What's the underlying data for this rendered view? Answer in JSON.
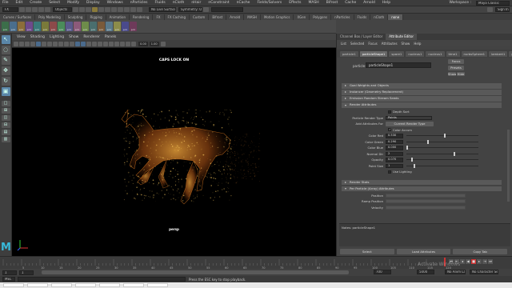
{
  "menubar": {
    "items": [
      "File",
      "Edit",
      "Create",
      "Select",
      "Modify",
      "Display",
      "Windows",
      "nParticles",
      "Fluids",
      "nCloth",
      "nHair",
      "nConstraint",
      "nCache",
      "Fields/Solvers",
      "Effects",
      "MASH",
      "Bifrost",
      "Cache",
      "Arnold",
      "Help"
    ],
    "workspace_label": "Workspace :",
    "workspace_value": "Maya Classic"
  },
  "statusline": {
    "mode": "FX",
    "objects": "Objects",
    "live_surface": "No Live Surface",
    "symmetry": "Symmetry: Off",
    "sign_in": "Sign In"
  },
  "shelf": {
    "tabs": [
      "Curves / Surfaces",
      "Poly Modeling",
      "Sculpting",
      "Rigging",
      "Animation",
      "Rendering",
      "FX",
      "FX Caching",
      "Custom",
      "Bifrost",
      "Arnold",
      "MASH",
      "Motion Graphics",
      "XGen",
      "Polygons",
      "nParticles",
      "Fluids",
      "nCloth",
      "none"
    ],
    "active_tab": "none",
    "buttons": [
      "pdc",
      "pdc",
      "pdc",
      "pdc",
      "pdc",
      "pdc",
      "pdc",
      "pdc",
      "pdc",
      "pdc",
      "pdc",
      "pdc",
      "pdc",
      "pdc",
      "pdc",
      "pdc",
      "pdc"
    ]
  },
  "viewport": {
    "menu": [
      "View",
      "Shading",
      "Lighting",
      "Show",
      "Renderer",
      "Panels"
    ],
    "field1": "0.00",
    "field2": "1.00",
    "hud_caps": "CAPS LOCK ON",
    "camera": "persp"
  },
  "right_panel": {
    "tabs": [
      "Channel Box / Layer Editor",
      "Attribute Editor"
    ],
    "menu": [
      "List",
      "Selected",
      "Focus",
      "Attributes",
      "Show",
      "Help"
    ],
    "node_tabs": [
      "particle1",
      "particleShape1",
      "spare1",
      "nucleus1",
      "nucleus1",
      "time1",
      "nurbsSphere1",
      "lambert1",
      "particleCloud1"
    ],
    "shape_label": "particle:",
    "shape_value": "particleShape1",
    "focus_btn": "Focus",
    "presets_btn": "Presets",
    "show_btn": "Show",
    "hide_btn": "Hide",
    "sections_top": [
      "Goal Weights and Objects",
      "Instancer (Geometry Replacement)",
      "Emission Random Stream Seeds"
    ],
    "render_attrs_title": "Render Attributes",
    "depth_sort": "Depth Sort",
    "particle_render_type_label": "Particle Render Type",
    "particle_render_type_value": "Points",
    "add_attrs_label": "Add Attributes For",
    "current_render_type_btn": "Current Render Type",
    "color_accum": "Color Accum",
    "attrs": [
      {
        "label": "Color Red",
        "value": "0.530",
        "knob": 0.53
      },
      {
        "label": "Color Green",
        "value": "0.290",
        "knob": 0.29
      },
      {
        "label": "Color Blue",
        "value": "0.000",
        "knob": 0.0
      },
      {
        "label": "Normal Dir",
        "value": "2",
        "knob": 0.67
      },
      {
        "label": "Opacity",
        "value": "0.070",
        "knob": 0.07
      },
      {
        "label": "Point Size",
        "value": "1",
        "knob": 0.1
      }
    ],
    "use_lighting": "Use Lighting",
    "render_stats": "Render Stats",
    "per_particle_title": "Per Particle (Array) Attributes",
    "pp_attrs": [
      "Position",
      "Ramp Position",
      "Velocity"
    ],
    "notes_label": "Notes:  particleShape1",
    "buttons": [
      "Select",
      "Load Attributes",
      "Copy Tab"
    ]
  },
  "timeline": {
    "ticks": [
      "5",
      "10",
      "15",
      "20",
      "25",
      "30",
      "35",
      "40",
      "45",
      "50",
      "55",
      "60",
      "65",
      "70",
      "75",
      "80",
      "85",
      "90",
      "95",
      "100",
      "105",
      "110",
      "115",
      "120"
    ],
    "current_frame": "120"
  },
  "range": {
    "start": "1",
    "end": "120",
    "range_end": "700",
    "anim_end": "5000",
    "no_character_set": "No Character Set",
    "no_anim_layer": "No Anim Layer",
    "fps": "24 fps"
  },
  "cmdline": {
    "lang": "MEL",
    "help": "Press the ESC key to stop playback."
  },
  "watermark": {
    "title": "Activate Windows",
    "sub": "Go to Settings to activate Windows."
  }
}
